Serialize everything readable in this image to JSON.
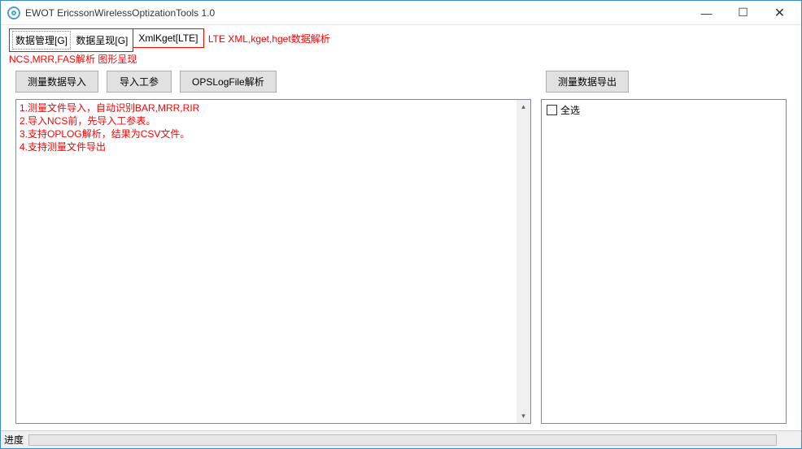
{
  "window": {
    "title": "EWOT EricssonWirelessOptizationTools 1.0"
  },
  "menu": {
    "group1": {
      "items": [
        {
          "label": "数据管理[G]"
        },
        {
          "label": "数据呈现[G]"
        }
      ],
      "caption": "NCS,MRR,FAS解析 图形呈现"
    },
    "group2": {
      "items": [
        {
          "label": "XmlKget[LTE]"
        }
      ]
    },
    "side_caption": "LTE XML,kget,hget数据解析"
  },
  "toolbar": {
    "import_measure": "测量数据导入",
    "import_engparam": "导入工参",
    "opslog_parse": "OPSLogFile解析",
    "export_measure": "测量数据导出"
  },
  "left_text": "1.测量文件导入，自动识别BAR,MRR,RIR\n2.导入NCS前，先导入工参表。\n3.支持OPLOG解析，结果为CSV文件。\n4.支持测量文件导出",
  "right_panel": {
    "select_all": "全选"
  },
  "status": {
    "label": "进度"
  }
}
